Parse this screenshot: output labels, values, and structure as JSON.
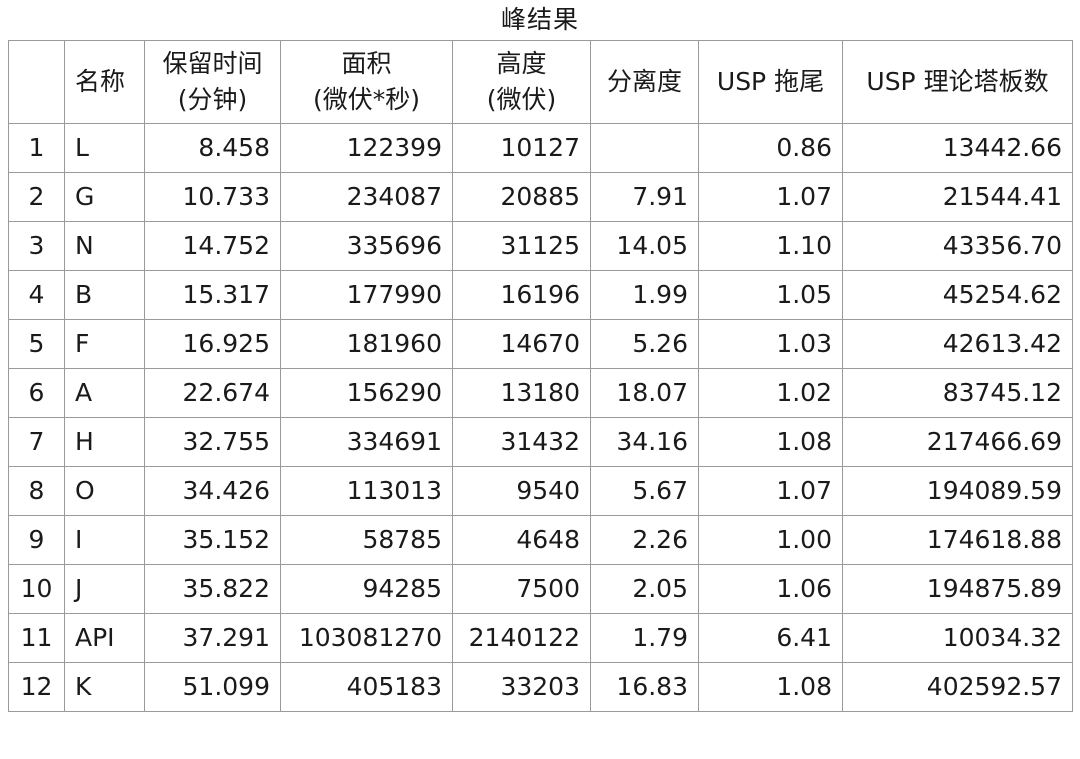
{
  "title": "峰结果",
  "columns": [
    {
      "line1": "",
      "line2": ""
    },
    {
      "line1": "名称",
      "line2": ""
    },
    {
      "line1": "保留时间",
      "line2": "(分钟)"
    },
    {
      "line1": "面积",
      "line2": "(微伏*秒)"
    },
    {
      "line1": "高度",
      "line2": "(微伏)"
    },
    {
      "line1": "分离度",
      "line2": ""
    },
    {
      "line1": "USP 拖尾",
      "line2": ""
    },
    {
      "line1": "USP 理论塔板数",
      "line2": ""
    }
  ],
  "rows": [
    [
      "1",
      "L",
      "8.458",
      "122399",
      "10127",
      "",
      "0.86",
      "13442.66"
    ],
    [
      "2",
      "G",
      "10.733",
      "234087",
      "20885",
      "7.91",
      "1.07",
      "21544.41"
    ],
    [
      "3",
      "N",
      "14.752",
      "335696",
      "31125",
      "14.05",
      "1.10",
      "43356.70"
    ],
    [
      "4",
      "B",
      "15.317",
      "177990",
      "16196",
      "1.99",
      "1.05",
      "45254.62"
    ],
    [
      "5",
      "F",
      "16.925",
      "181960",
      "14670",
      "5.26",
      "1.03",
      "42613.42"
    ],
    [
      "6",
      "A",
      "22.674",
      "156290",
      "13180",
      "18.07",
      "1.02",
      "83745.12"
    ],
    [
      "7",
      "H",
      "32.755",
      "334691",
      "31432",
      "34.16",
      "1.08",
      "217466.69"
    ],
    [
      "8",
      "O",
      "34.426",
      "113013",
      "9540",
      "5.67",
      "1.07",
      "194089.59"
    ],
    [
      "9",
      "I",
      "35.152",
      "58785",
      "4648",
      "2.26",
      "1.00",
      "174618.88"
    ],
    [
      "10",
      "J",
      "35.822",
      "94285",
      "7500",
      "2.05",
      "1.06",
      "194875.89"
    ],
    [
      "11",
      "API",
      "37.291",
      "103081270",
      "2140122",
      "1.79",
      "6.41",
      "10034.32"
    ],
    [
      "12",
      "K",
      "51.099",
      "405183",
      "33203",
      "16.83",
      "1.08",
      "402592.57"
    ]
  ]
}
